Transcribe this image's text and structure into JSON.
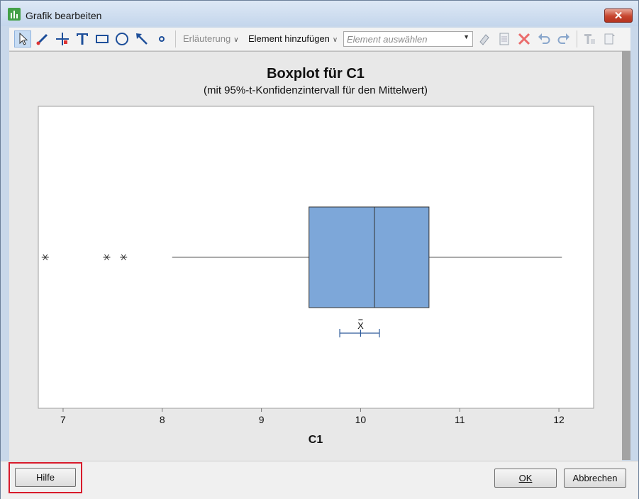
{
  "window": {
    "title": "Grafik bearbeiten",
    "close_glyph": "✕"
  },
  "toolbar": {
    "tools": [
      "select-arrow-icon",
      "brush-icon",
      "crosshair-icon",
      "text-tool-icon",
      "rectangle-icon",
      "ellipse-icon",
      "arrow-line-icon",
      "point-icon"
    ],
    "annotation_label": "Erläuterung",
    "add_element_label": "Element hinzufügen",
    "element_select_placeholder": "Element auswählen",
    "action_icons": [
      "edit-icon",
      "properties-icon",
      "delete-icon",
      "undo-icon",
      "redo-icon",
      "text-format-icon",
      "page-icon"
    ]
  },
  "chart_data": {
    "type": "boxplot",
    "title": "Boxplot für C1",
    "subtitle": "(mit 95%-t-Konfidenzintervall für den Mittelwert)",
    "xlabel": "C1",
    "ylabel": "",
    "xlim": [
      6.75,
      12.35
    ],
    "ticks": [
      "7",
      "8",
      "9",
      "10",
      "11",
      "12"
    ],
    "tick_values": [
      7,
      8,
      9,
      10,
      11,
      12
    ],
    "box": {
      "q1": 9.48,
      "median": 10.14,
      "q3": 10.69,
      "whisker_low": 8.1,
      "whisker_high": 12.03
    },
    "outliers": [
      6.82,
      7.44,
      7.61
    ],
    "mean": 10.0,
    "mean_label": "X",
    "ci": [
      9.79,
      10.19
    ],
    "box_color": "#7da7d9",
    "ci_color": "#2d5a9a"
  },
  "buttons": {
    "help": "Hilfe",
    "ok": "OK",
    "cancel": "Abbrechen"
  }
}
